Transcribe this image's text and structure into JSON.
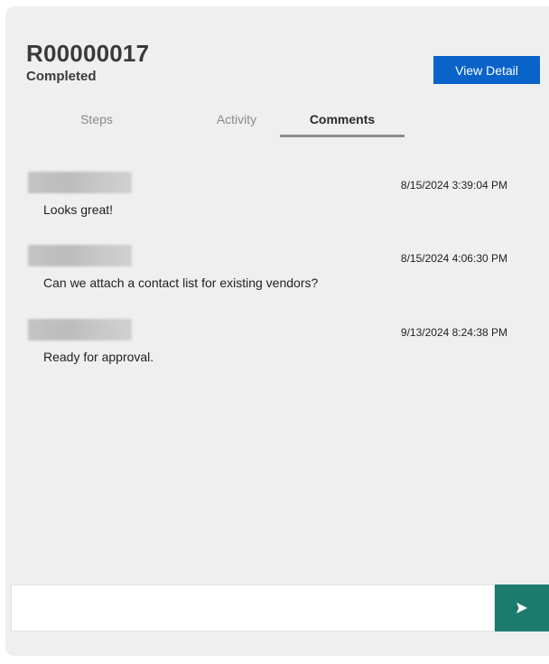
{
  "request": {
    "id": "R00000017",
    "status": "Completed"
  },
  "actions": {
    "view_detail_label": "View Detail"
  },
  "tabs": [
    {
      "label": "Steps",
      "active": false
    },
    {
      "label": "Activity",
      "active": false
    },
    {
      "label": "Comments",
      "active": true
    }
  ],
  "comments": [
    {
      "author": "",
      "timestamp": "8/15/2024 3:39:04 PM",
      "text": "Looks great!"
    },
    {
      "author": "",
      "timestamp": "8/15/2024 4:06:30 PM",
      "text": "Can we attach a contact list for existing vendors?"
    },
    {
      "author": "",
      "timestamp": "9/13/2024 8:24:38 PM",
      "text": "Ready for approval."
    }
  ],
  "composer": {
    "value": "",
    "placeholder": ""
  },
  "icons": {
    "send": "send-arrow-icon"
  },
  "colors": {
    "primary_button": "#0a63c9",
    "send_button": "#1c7a6f",
    "panel_background": "#efefef"
  }
}
